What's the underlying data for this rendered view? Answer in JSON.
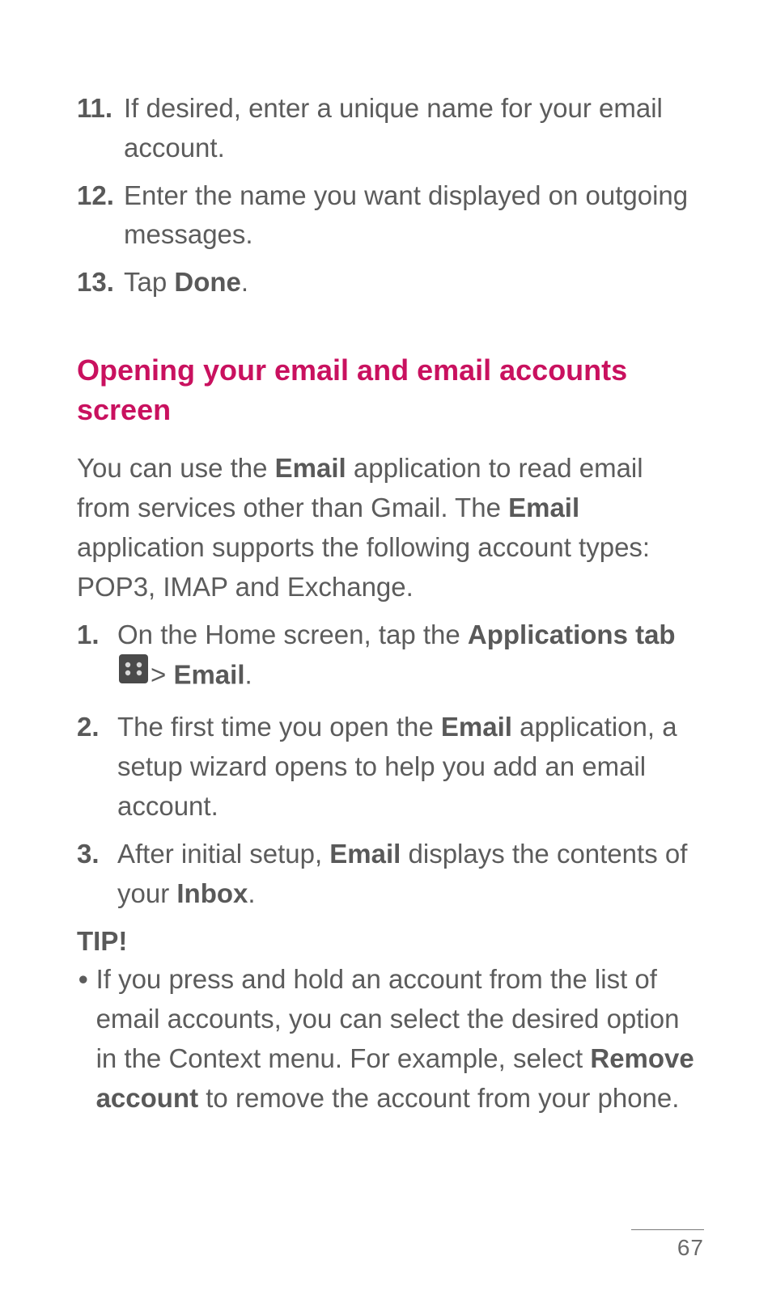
{
  "ol_top": {
    "items": [
      {
        "num": "11.",
        "text": "If desired, enter a unique name for your email account."
      },
      {
        "num": "12.",
        "text": "Enter the name you want displayed on outgoing messages."
      },
      {
        "num": "13.",
        "pre": "Tap ",
        "bold": "Done",
        "post": "."
      }
    ]
  },
  "heading": "Opening your email and email accounts screen",
  "intro": {
    "p1a": "You can use the ",
    "p1b": "Email",
    "p1c": " application to read email from services other than Gmail. The ",
    "p1d": "Email",
    "p1e": " application supports the following account types: POP3, IMAP and  Exchange."
  },
  "ol_main": {
    "s1": {
      "num": "1.",
      "a": "On the Home screen, tap the ",
      "b": "Applications tab",
      "c": " ",
      "d": ">",
      "e": " ",
      "f": "Email",
      "g": "."
    },
    "s2": {
      "num": "2.",
      "a": "The first time you open the ",
      "b": "Email",
      "c": " application, a setup wizard opens to help you add an email account."
    },
    "s3": {
      "num": "3.",
      "a": "After initial setup, ",
      "b": "Email",
      "c": " displays the contents of your ",
      "d": "Inbox",
      "e": "."
    }
  },
  "tip": {
    "label": "TIP!",
    "bullet": "•",
    "a": "If you press and hold an account from the list of email accounts, you can select the desired option in the Context menu. For example, select ",
    "b": "Remove account",
    "c": " to remove the account from your phone."
  },
  "page_number": "67"
}
